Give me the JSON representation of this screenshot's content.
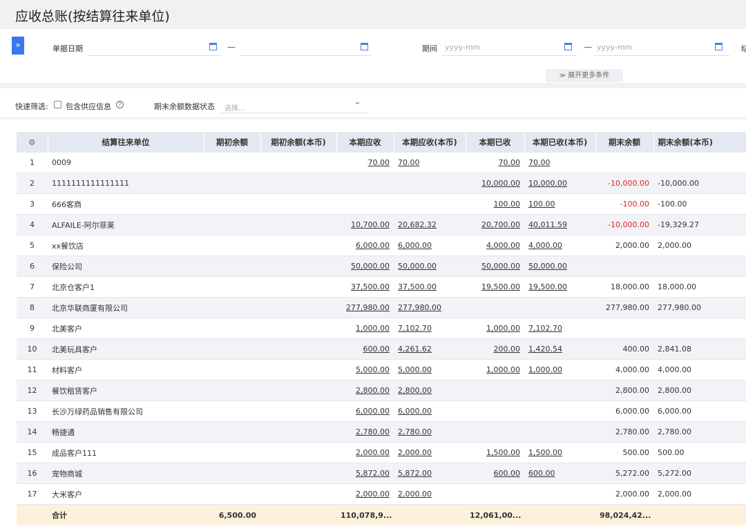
{
  "page": {
    "title": "应收总账(按结算往来单位)"
  },
  "filters": {
    "toggle_glyph": "»",
    "date_label": "单据日期",
    "dash": "—",
    "period_label": "期间",
    "period_placeholder": "yyyy-mm",
    "cutoff_label": "结",
    "more_label": "展开更多条件",
    "more_glyph": "≫"
  },
  "quick": {
    "label": "快速筛选:",
    "include_supplier": "包含供应信息",
    "help_glyph": "?",
    "status_label": "期末余额数据状态",
    "status_placeholder": "选择..."
  },
  "table": {
    "settings_glyph": "⚙",
    "columns": [
      "结算往来单位",
      "期初余额",
      "期初余额(本币)",
      "本期应收",
      "本期应收(本币)",
      "本期已收",
      "本期已收(本币)",
      "期末余额",
      "期末余额(本币)"
    ],
    "rows": [
      {
        "no": "1",
        "name": "0009",
        "open": "",
        "open_local": "",
        "ar": "70.00",
        "ar_local": "70.00",
        "rec": "70.00",
        "rec_local": "70.00",
        "end": "",
        "end_local": "",
        "neg": false
      },
      {
        "no": "2",
        "name": "1111111111111111",
        "open": "",
        "open_local": "",
        "ar": "",
        "ar_local": "",
        "rec": "10,000.00",
        "rec_local": "10,000.00",
        "end": "-10,000.00",
        "end_local": "-10,000.00",
        "neg": true
      },
      {
        "no": "3",
        "name": "666客商",
        "open": "",
        "open_local": "",
        "ar": "",
        "ar_local": "",
        "rec": "100.00",
        "rec_local": "100.00",
        "end": "-100.00",
        "end_local": "-100.00",
        "neg": true
      },
      {
        "no": "4",
        "name": "ALFAILE-阿尔菲莱",
        "open": "",
        "open_local": "",
        "ar": "10,700.00",
        "ar_local": "20,682.32",
        "rec": "20,700.00",
        "rec_local": "40,011.59",
        "end": "-10,000.00",
        "end_local": "-19,329.27",
        "neg": true
      },
      {
        "no": "5",
        "name": "xx餐饮店",
        "open": "",
        "open_local": "",
        "ar": "6,000.00",
        "ar_local": "6,000.00",
        "rec": "4,000.00",
        "rec_local": "4,000.00",
        "end": "2,000.00",
        "end_local": "2,000.00",
        "neg": false
      },
      {
        "no": "6",
        "name": "保险公司",
        "open": "",
        "open_local": "",
        "ar": "50,000.00",
        "ar_local": "50,000.00",
        "rec": "50,000.00",
        "rec_local": "50,000.00",
        "end": "",
        "end_local": "",
        "neg": false
      },
      {
        "no": "7",
        "name": "北京仓客户1",
        "open": "",
        "open_local": "",
        "ar": "37,500.00",
        "ar_local": "37,500.00",
        "rec": "19,500.00",
        "rec_local": "19,500.00",
        "end": "18,000.00",
        "end_local": "18,000.00",
        "neg": false
      },
      {
        "no": "8",
        "name": "北京华联商厦有限公司",
        "open": "",
        "open_local": "",
        "ar": "277,980.00",
        "ar_local": "277,980.00",
        "rec": "",
        "rec_local": "",
        "end": "277,980.00",
        "end_local": "277,980.00",
        "neg": false
      },
      {
        "no": "9",
        "name": "北美客户",
        "open": "",
        "open_local": "",
        "ar": "1,000.00",
        "ar_local": "7,102.70",
        "rec": "1,000.00",
        "rec_local": "7,102.70",
        "end": "",
        "end_local": "",
        "neg": false
      },
      {
        "no": "10",
        "name": "北美玩具客户",
        "open": "",
        "open_local": "",
        "ar": "600.00",
        "ar_local": "4,261.62",
        "rec": "200.00",
        "rec_local": "1,420.54",
        "end": "400.00",
        "end_local": "2,841.08",
        "neg": false
      },
      {
        "no": "11",
        "name": "材料客户",
        "open": "",
        "open_local": "",
        "ar": "5,000.00",
        "ar_local": "5,000.00",
        "rec": "1,000.00",
        "rec_local": "1,000.00",
        "end": "4,000.00",
        "end_local": "4,000.00",
        "neg": false
      },
      {
        "no": "12",
        "name": "餐饮租赁客户",
        "open": "",
        "open_local": "",
        "ar": "2,800.00",
        "ar_local": "2,800.00",
        "rec": "",
        "rec_local": "",
        "end": "2,800.00",
        "end_local": "2,800.00",
        "neg": false
      },
      {
        "no": "13",
        "name": "长沙万绿药品销售有限公司",
        "open": "",
        "open_local": "",
        "ar": "6,000.00",
        "ar_local": "6,000.00",
        "rec": "",
        "rec_local": "",
        "end": "6,000.00",
        "end_local": "6,000.00",
        "neg": false
      },
      {
        "no": "14",
        "name": "畅捷通",
        "open": "",
        "open_local": "",
        "ar": "2,780.00",
        "ar_local": "2,780.00",
        "rec": "",
        "rec_local": "",
        "end": "2,780.00",
        "end_local": "2,780.00",
        "neg": false
      },
      {
        "no": "15",
        "name": "成品客户111",
        "open": "",
        "open_local": "",
        "ar": "2,000.00",
        "ar_local": "2,000.00",
        "rec": "1,500.00",
        "rec_local": "1,500.00",
        "end": "500.00",
        "end_local": "500.00",
        "neg": false
      },
      {
        "no": "16",
        "name": "宠物商城",
        "open": "",
        "open_local": "",
        "ar": "5,872.00",
        "ar_local": "5,872.00",
        "rec": "600.00",
        "rec_local": "600.00",
        "end": "5,272.00",
        "end_local": "5,272.00",
        "neg": false
      },
      {
        "no": "17",
        "name": "大米客户",
        "open": "",
        "open_local": "",
        "ar": "2,000.00",
        "ar_local": "2,000.00",
        "rec": "",
        "rec_local": "",
        "end": "2,000.00",
        "end_local": "2,000.00",
        "neg": false
      }
    ],
    "total": {
      "label": "合计",
      "open": "6,500.00",
      "open_local": "",
      "ar": "110,078,9...",
      "ar_local": "",
      "rec": "12,061,00...",
      "rec_local": "",
      "end": "98,024,42...",
      "end_local": ""
    }
  },
  "colors": {
    "accent": "#3a78f2",
    "negative": "#e02020",
    "total_bg": "#fdf0dd",
    "header_bg": "#e4e8f0"
  }
}
